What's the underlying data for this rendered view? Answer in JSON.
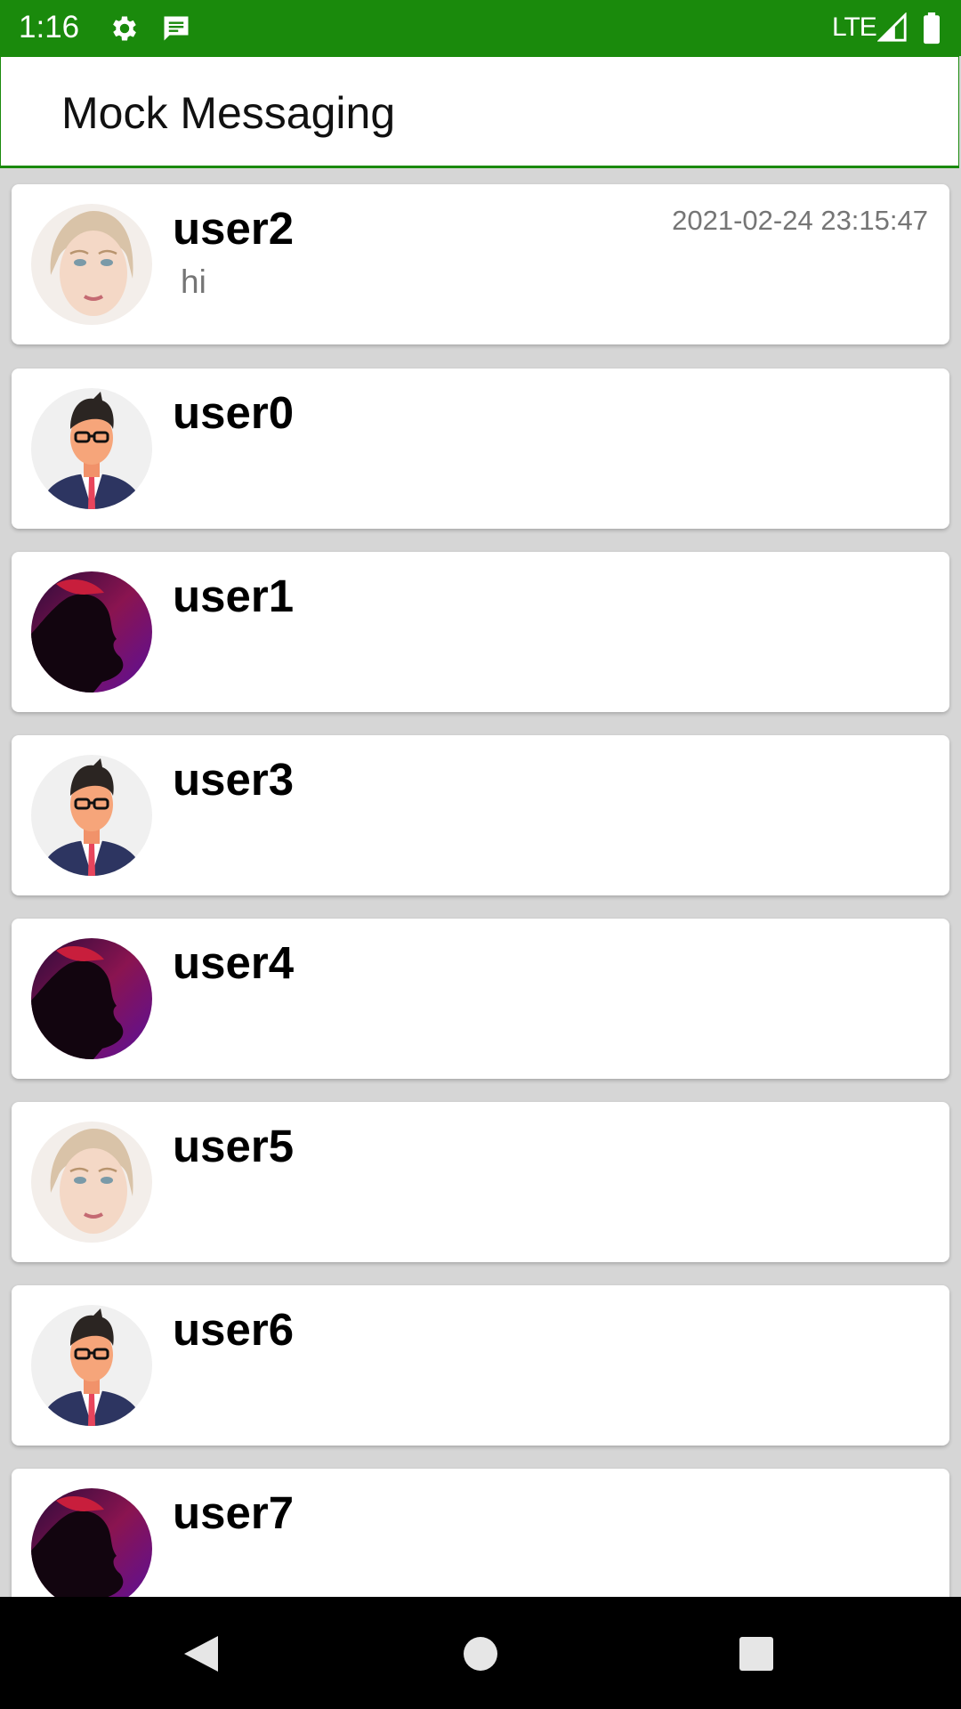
{
  "status_bar": {
    "time": "1:16",
    "network": "LTE",
    "icons": [
      "settings-icon",
      "message-icon",
      "signal-icon",
      "battery-icon"
    ],
    "color": "#1a8a0c"
  },
  "app_bar": {
    "title": "Mock Messaging"
  },
  "conversations": [
    {
      "name": "user2",
      "timestamp": "2021-02-24 23:15:47",
      "preview": "hi",
      "avatar": "girl-avatar"
    },
    {
      "name": "user0",
      "timestamp": "",
      "preview": "",
      "avatar": "businessman-avatar"
    },
    {
      "name": "user1",
      "timestamp": "",
      "preview": "",
      "avatar": "silhouette-avatar"
    },
    {
      "name": "user3",
      "timestamp": "",
      "preview": "",
      "avatar": "businessman-avatar"
    },
    {
      "name": "user4",
      "timestamp": "",
      "preview": "",
      "avatar": "silhouette-avatar"
    },
    {
      "name": "user5",
      "timestamp": "",
      "preview": "",
      "avatar": "girl-avatar"
    },
    {
      "name": "user6",
      "timestamp": "",
      "preview": "",
      "avatar": "businessman-avatar"
    },
    {
      "name": "user7",
      "timestamp": "",
      "preview": "",
      "avatar": "silhouette-avatar"
    }
  ],
  "nav_bar": {
    "buttons": [
      "back-icon",
      "home-icon",
      "recents-icon"
    ]
  }
}
